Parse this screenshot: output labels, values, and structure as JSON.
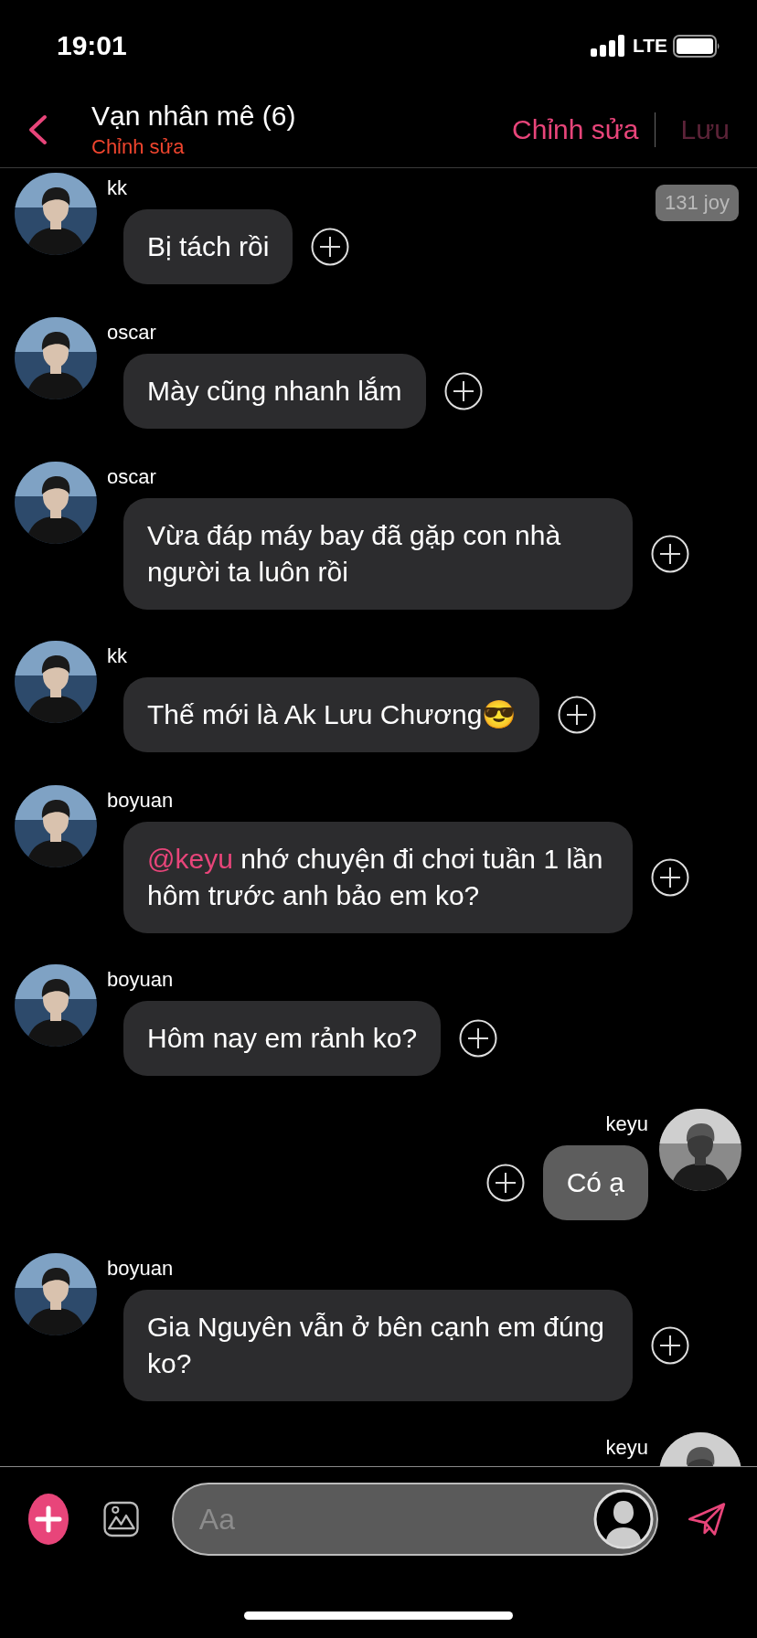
{
  "status_bar": {
    "time": "19:01",
    "network": "LTE"
  },
  "header": {
    "title": "Vạn nhân mê (6)",
    "subtitle": "Chỉnh sửa",
    "actions": [
      {
        "label": "Chỉnh sửa",
        "disabled": false
      },
      {
        "label": "Lưu",
        "disabled": true
      }
    ]
  },
  "badge": "131 joy",
  "messages": [
    {
      "sender": "kk",
      "kind": "incoming",
      "text": "Bị tách rồi"
    },
    {
      "sender": "oscar",
      "kind": "incoming",
      "text": "Mày cũng nhanh lắm"
    },
    {
      "sender": "oscar",
      "kind": "incoming",
      "text": "Vừa đáp máy bay đã gặp con nhà người ta luôn rồi"
    },
    {
      "sender": "kk",
      "kind": "incoming",
      "text": "Thế mới là Ak Lưu Chương😎"
    },
    {
      "sender": "boyuan",
      "kind": "incoming",
      "mention": "@keyu",
      "text": " nhớ chuyện đi chơi tuần 1 lần hôm trước anh bảo em ko?"
    },
    {
      "sender": "boyuan",
      "kind": "incoming",
      "text": "Hôm nay em rảnh ko?"
    },
    {
      "sender": "keyu",
      "kind": "outgoing",
      "text": "Có ạ"
    },
    {
      "sender": "boyuan",
      "kind": "incoming",
      "text": "Gia Nguyên vẫn ở bên cạnh em đúng ko?"
    },
    {
      "sender": "keyu",
      "kind": "outgoing"
    }
  ],
  "composer": {
    "placeholder": "Aa"
  }
}
